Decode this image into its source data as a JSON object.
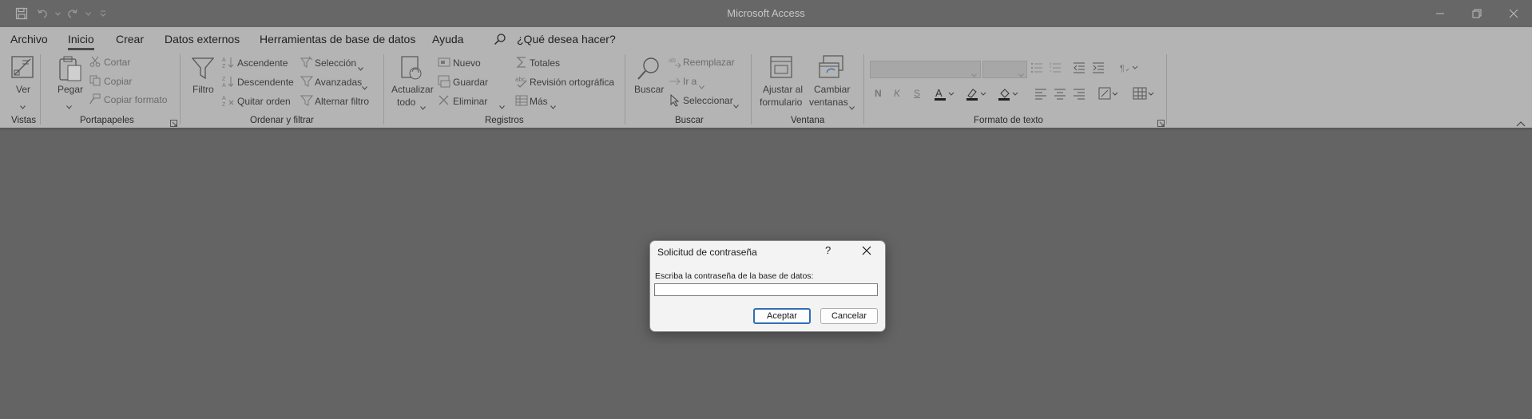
{
  "window": {
    "title": "Microsoft Access",
    "icons": [
      "save-icon",
      "undo-icon",
      "redo-icon",
      "customize-qat-icon",
      "minimize-icon",
      "restore-icon",
      "close-icon"
    ]
  },
  "menu": {
    "items": [
      "Archivo",
      "Inicio",
      "Crear",
      "Datos externos",
      "Herramientas de base de datos",
      "Ayuda"
    ],
    "active": "Inicio",
    "search": "¿Qué desea hacer?"
  },
  "ribbon": {
    "vistas": {
      "label": "Vistas",
      "ver": "Ver"
    },
    "portapapeles": {
      "label": "Portapapeles",
      "pegar": "Pegar",
      "cortar": "Cortar",
      "copiar": "Copiar",
      "copiar_formato": "Copiar formato"
    },
    "ordenar": {
      "label": "Ordenar y filtrar",
      "filtro": "Filtro",
      "ascendente": "Ascendente",
      "descendente": "Descendente",
      "quitar_orden": "Quitar orden",
      "seleccion": "Selección",
      "avanzadas": "Avanzadas",
      "alternar_filtro": "Alternar filtro"
    },
    "registros": {
      "label": "Registros",
      "actualizar1": "Actualizar",
      "actualizar2": "todo",
      "nuevo": "Nuevo",
      "guardar": "Guardar",
      "eliminar": "Eliminar",
      "totales": "Totales",
      "revision": "Revisión ortográfica",
      "mas": "Más"
    },
    "buscar": {
      "label": "Buscar",
      "buscar": "Buscar",
      "reemplazar": "Reemplazar",
      "ir_a": "Ir a",
      "seleccionar": "Seleccionar"
    },
    "ventana": {
      "label": "Ventana",
      "ajustar1": "Ajustar al",
      "ajustar2": "formulario",
      "cambiar1": "Cambiar",
      "cambiar2": "ventanas"
    },
    "formato": {
      "label": "Formato de texto",
      "bold": "N",
      "italic": "K",
      "underline": "S"
    },
    "accent_colors": {
      "font_color": "#1f1f1f",
      "highlight": "#1f1f1f"
    }
  },
  "dialog": {
    "title": "Solicitud de contraseña",
    "help": "?",
    "prompt": "Escriba la contraseña de la base de datos:",
    "password_value": "",
    "accept": "Aceptar",
    "cancel": "Cancelar",
    "accent": "#2f6fb5"
  }
}
